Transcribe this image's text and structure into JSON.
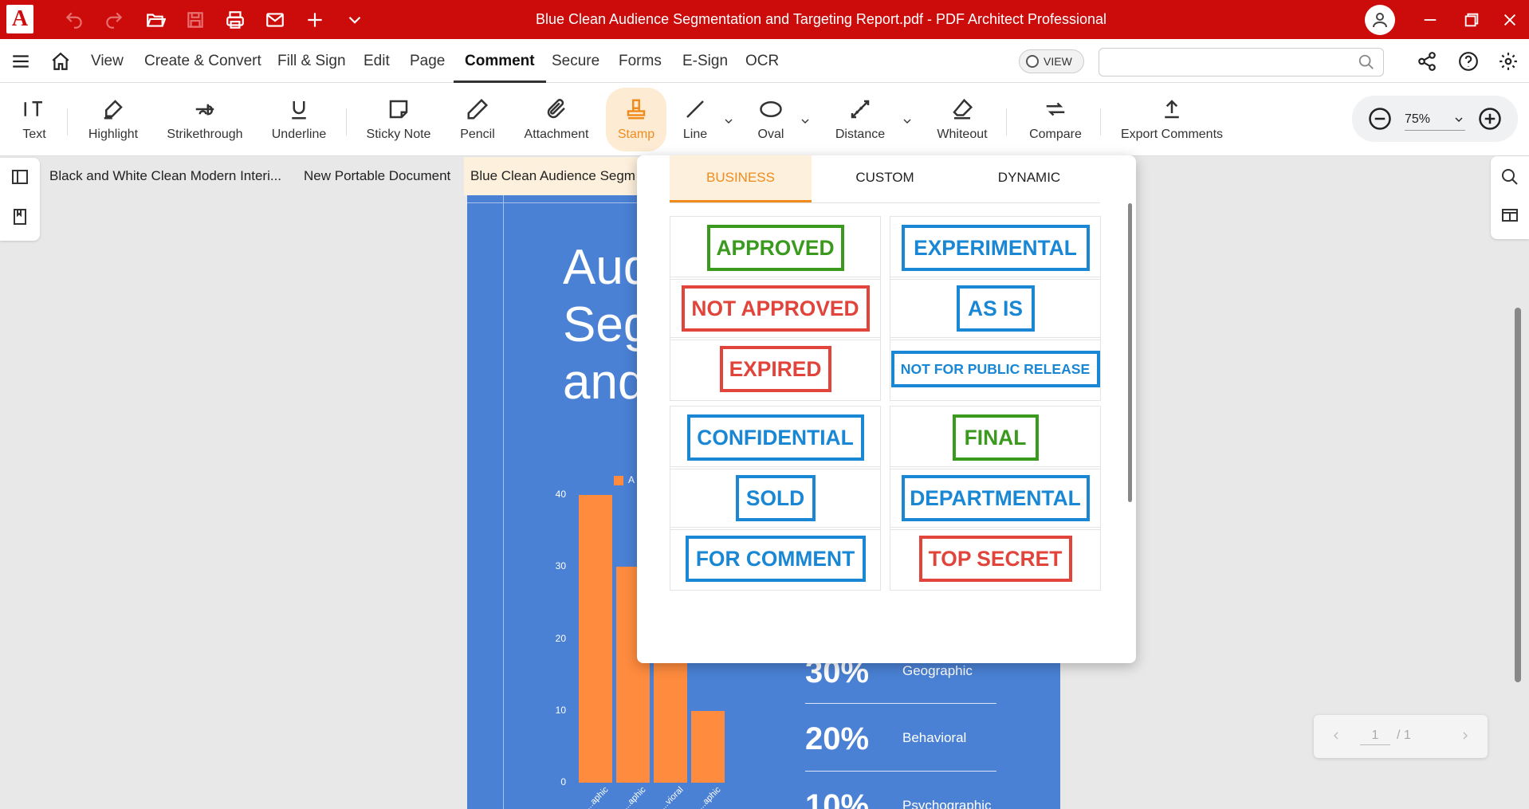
{
  "titlebar": {
    "logo": "A",
    "title": "Blue Clean Audience Segmentation and Targeting Report.pdf   -   PDF Architect Professional"
  },
  "menubar": {
    "items": [
      "View",
      "Create & Convert",
      "Fill & Sign",
      "Edit",
      "Page",
      "Comment",
      "Secure",
      "Forms",
      "E-Sign",
      "OCR"
    ],
    "active": "Comment",
    "view_toggle": "VIEW",
    "search_placeholder": ""
  },
  "ribbon": {
    "tools": [
      "Text",
      "Highlight",
      "Strikethrough",
      "Underline",
      "Sticky Note",
      "Pencil",
      "Attachment",
      "Stamp",
      "Line",
      "Oval",
      "Distance",
      "Whiteout",
      "Compare",
      "Export Comments"
    ],
    "active": "Stamp",
    "zoom": "75%"
  },
  "doc_tabs": [
    "Black and White Clean Modern Interi...",
    "New Portable Document",
    "Blue Clean Audience Segm"
  ],
  "document": {
    "title_lines": [
      "Aud",
      "Seg",
      "and"
    ],
    "legend": "A",
    "stats": [
      {
        "pct": "30%",
        "label": "Geographic"
      },
      {
        "pct": "20%",
        "label": "Behavioral"
      },
      {
        "pct": "10%",
        "label": "Psychographic"
      }
    ]
  },
  "chart_data": {
    "type": "bar",
    "categories": [
      "...aphic",
      "...aphic",
      "...vioral",
      "...aphic"
    ],
    "values": [
      40,
      30,
      20,
      10
    ],
    "yticks": [
      "0",
      "10",
      "20",
      "30",
      "40"
    ],
    "ylim": [
      0,
      40
    ],
    "series_color": "#fe8b3e"
  },
  "stamp_panel": {
    "tabs": [
      "BUSINESS",
      "CUSTOM",
      "DYNAMIC"
    ],
    "active_tab": "BUSINESS",
    "stamps": [
      {
        "label": "APPROVED",
        "color": "#3a9a1e"
      },
      {
        "label": "EXPERIMENTAL",
        "color": "#1a87d4"
      },
      {
        "label": "NOT APPROVED",
        "color": "#e0443a"
      },
      {
        "label": "AS IS",
        "color": "#1a87d4"
      },
      {
        "label": "EXPIRED",
        "color": "#e0443a"
      },
      {
        "label": "NOT FOR PUBLIC RELEASE",
        "color": "#1a87d4"
      },
      {
        "label": "CONFIDENTIAL",
        "color": "#1a87d4"
      },
      {
        "label": "FINAL",
        "color": "#3a9a1e"
      },
      {
        "label": "SOLD",
        "color": "#1a87d4"
      },
      {
        "label": "DEPARTMENTAL",
        "color": "#1a87d4"
      },
      {
        "label": "FOR COMMENT",
        "color": "#1a87d4"
      },
      {
        "label": "TOP SECRET",
        "color": "#e0443a"
      }
    ]
  },
  "pager": {
    "current": "1",
    "total": "/ 1"
  }
}
